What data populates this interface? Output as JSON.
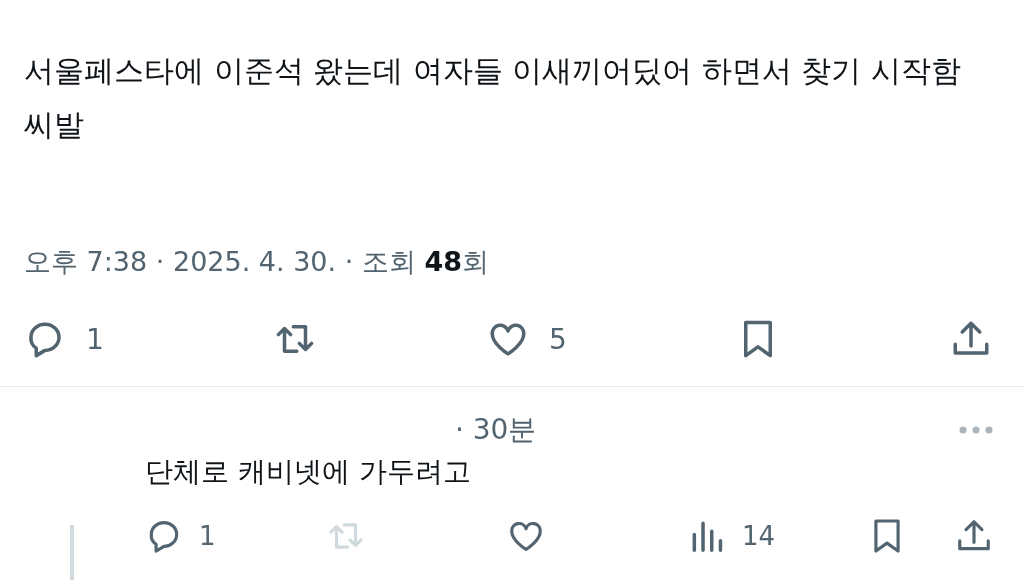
{
  "post": {
    "text": "서울페스타에 이준석 왔는데 여자들 이새끼어딨어 하면서 찾기 시작함 씨발",
    "meta": "오후 7:38 · 2025. 4. 30. · 조회 **48**회",
    "actions": [
      {
        "kind": "reply",
        "count": "1",
        "disabled": false
      },
      {
        "kind": "retweet",
        "disabled": false
      },
      {
        "kind": "like",
        "count": "5",
        "disabled": false
      },
      {
        "kind": "bookmark",
        "disabled": false
      },
      {
        "kind": "share",
        "disabled": false
      }
    ]
  },
  "reply": {
    "time": "· 30분",
    "text": "단체로 캐비넷에 가두려고",
    "actions": [
      {
        "kind": "reply",
        "count": "1",
        "disabled": false
      },
      {
        "kind": "retweet",
        "disabled": true
      },
      {
        "kind": "like",
        "disabled": false
      },
      {
        "kind": "views",
        "count": "14",
        "disabled": false
      },
      {
        "kind": "bookmark",
        "disabled": false
      },
      {
        "kind": "share",
        "disabled": false
      }
    ]
  }
}
